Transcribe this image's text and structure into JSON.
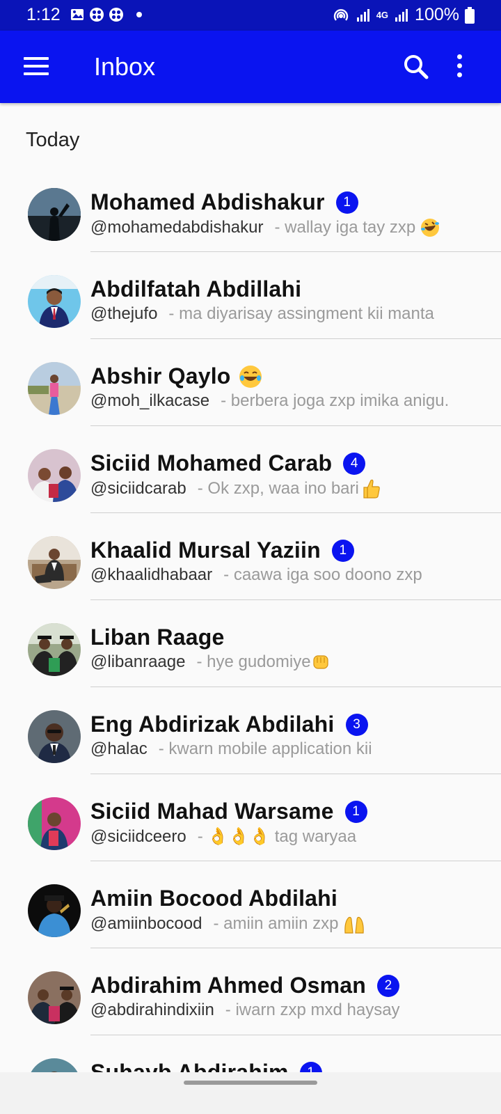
{
  "status_bar": {
    "time": "1:12",
    "battery": "100%",
    "network": "4G"
  },
  "app_bar": {
    "title": "Inbox",
    "bg_color": "#0a14f0"
  },
  "section": {
    "label": "Today"
  },
  "conversations": [
    {
      "name": "Mohamed Abdishakur",
      "handle": "@mohamedabdishakur",
      "preview": "- wallay iga tay zxp",
      "emoji": "rofl",
      "name_emoji": "",
      "unread": "1"
    },
    {
      "name": "Abdilfatah Abdillahi",
      "handle": "@thejufo",
      "preview": "- ma diyarisay assingment kii manta",
      "emoji": "",
      "name_emoji": "",
      "unread": ""
    },
    {
      "name": "Abshir Qaylo",
      "handle": "@moh_ilkacase",
      "preview": "- berbera joga zxp imika anigu.",
      "emoji": "",
      "name_emoji": "joy",
      "unread": ""
    },
    {
      "name": "Siciid Mohamed Carab",
      "handle": "@siciidcarab",
      "preview": "- Ok zxp, waa ino bari",
      "emoji": "thumbs-up",
      "name_emoji": "",
      "unread": "4"
    },
    {
      "name": "Khaalid Mursal Yaziin",
      "handle": "@khaalidhabaar",
      "preview": "- caawa iga soo doono zxp",
      "emoji": "",
      "name_emoji": "",
      "unread": "1"
    },
    {
      "name": "Liban Raage",
      "handle": "@libanraage",
      "preview": "- hye gudomiye",
      "emoji": "fist",
      "name_emoji": "",
      "unread": ""
    },
    {
      "name": "Eng Abdirizak Abdilahi",
      "handle": "@halac",
      "preview": "- kwarn mobile application kii",
      "emoji": "",
      "name_emoji": "",
      "unread": "3"
    },
    {
      "name": "Siciid Mahad Warsame",
      "handle": "@siciidceero",
      "preview": "- 👌👌👌 tag waryaa",
      "emoji": "",
      "name_emoji": "",
      "unread": "1"
    },
    {
      "name": "Amiin Bocood Abdilahi",
      "handle": "@amiinbocood",
      "preview": "- amiin amiin zxp",
      "emoji": "palms-up",
      "name_emoji": "",
      "unread": ""
    },
    {
      "name": "Abdirahim Ahmed Osman",
      "handle": "@abdirahindixiin",
      "preview": "- iwarn zxp mxd haysay",
      "emoji": "",
      "name_emoji": "",
      "unread": "2"
    },
    {
      "name": "Suhayb Abdirahim",
      "handle": "",
      "preview": "",
      "emoji": "",
      "name_emoji": "",
      "unread": "1"
    }
  ]
}
